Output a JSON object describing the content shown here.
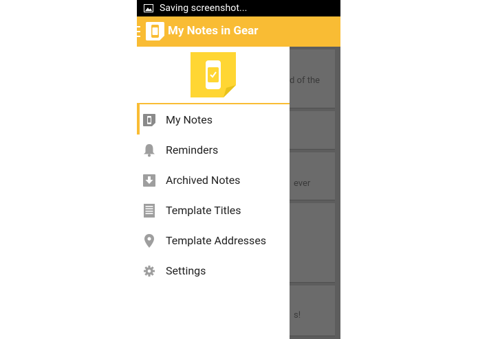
{
  "status_bar": {
    "text": "Saving screenshot..."
  },
  "action_bar": {
    "title": "My Notes in Gear"
  },
  "background_cards": [
    {
      "text": "d of the"
    },
    {
      "text": ""
    },
    {
      "text": "ever"
    },
    {
      "text": ""
    },
    {
      "text": "s!"
    }
  ],
  "drawer": {
    "items": [
      {
        "label": "My Notes",
        "icon": "note-watch-icon",
        "active": true
      },
      {
        "label": "Reminders",
        "icon": "bell-icon",
        "active": false
      },
      {
        "label": "Archived Notes",
        "icon": "archive-download-icon",
        "active": false
      },
      {
        "label": "Template Titles",
        "icon": "document-lines-icon",
        "active": false
      },
      {
        "label": "Template Addresses",
        "icon": "map-pin-icon",
        "active": false
      },
      {
        "label": "Settings",
        "icon": "gear-icon",
        "active": false
      }
    ]
  },
  "colors": {
    "accent": "#f9bc34",
    "drawer_background": "#ffffff",
    "scrim": "#5d5d5d",
    "icon_gray": "#9e9e9e"
  }
}
